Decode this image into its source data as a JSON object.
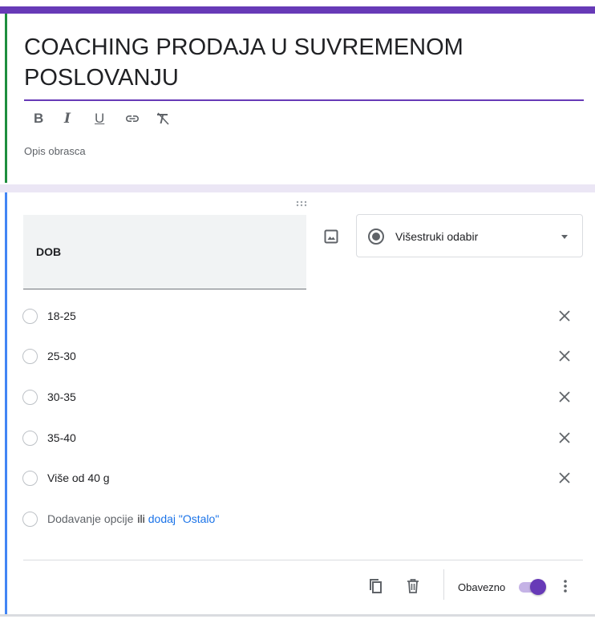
{
  "form": {
    "title": "COACHING PRODAJA U SUVREMENOM POSLOVANJU",
    "description_placeholder": "Opis obrasca",
    "toolbar": {
      "bold": "B",
      "italic": "I",
      "underline": "U",
      "link_icon": "link-icon",
      "clear_format_icon": "clear-format-icon"
    }
  },
  "question": {
    "title": "DOB",
    "type": "Višestruki odabir",
    "options": [
      "18-25",
      "25-30",
      "30-35",
      "35-40",
      "Više od 40 g"
    ],
    "add_option": "Dodavanje opcije",
    "or_text": "ili",
    "add_other": "dodaj \"Ostalo\"",
    "required_label": "Obavezno",
    "required": true
  },
  "colors": {
    "accent": "#673ab7",
    "active_card": "#4285f4",
    "link": "#1a73e8"
  }
}
